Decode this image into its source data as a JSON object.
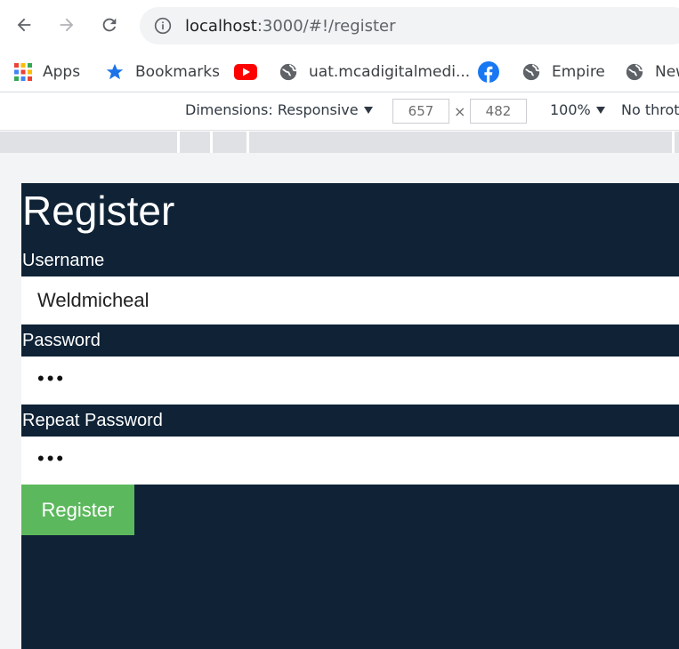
{
  "browser": {
    "url_host": "localhost",
    "url_path": ":3000/#!/register",
    "bookmarks": [
      {
        "label": "Apps",
        "icon": "apps-grid-icon"
      },
      {
        "label": "Bookmarks",
        "icon": "star-icon"
      },
      {
        "label": "",
        "icon": "youtube-icon"
      },
      {
        "label": "uat.mcadigitalmedi...",
        "icon": "globe-icon"
      },
      {
        "label": "",
        "icon": "facebook-icon"
      },
      {
        "label": "Empire",
        "icon": "globe-icon"
      },
      {
        "label": "New",
        "icon": "globe-icon"
      }
    ]
  },
  "devtools": {
    "dimensions_label": "Dimensions: Responsive",
    "width": "657",
    "times": "×",
    "height": "482",
    "zoom": "100%",
    "throttle": "No throt"
  },
  "form": {
    "title": "Register",
    "username_label": "Username",
    "username_value": "Weldmicheal",
    "password_label": "Password",
    "password_value": "•••",
    "repeat_label": "Repeat Password",
    "repeat_value": "•••",
    "submit_label": "Register"
  },
  "colors": {
    "panel": "#0f2236",
    "button": "#5cb85c"
  }
}
